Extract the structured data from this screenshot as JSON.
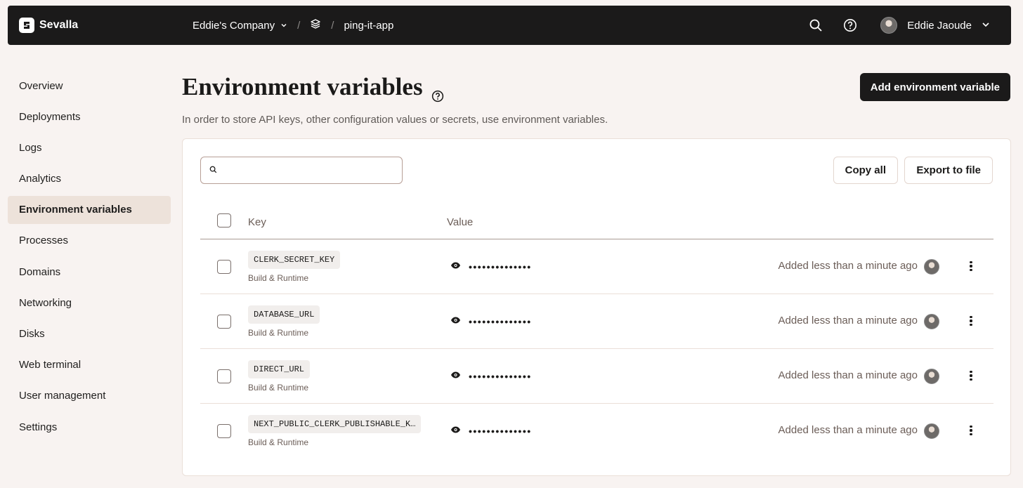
{
  "app": {
    "name": "Sevalla"
  },
  "breadcrumb": {
    "company": "Eddie's Company",
    "app_name": "ping-it-app"
  },
  "user": {
    "name": "Eddie Jaoude"
  },
  "sidebar": {
    "items": [
      {
        "label": "Overview"
      },
      {
        "label": "Deployments"
      },
      {
        "label": "Logs"
      },
      {
        "label": "Analytics"
      },
      {
        "label": "Environment variables",
        "active": true
      },
      {
        "label": "Processes"
      },
      {
        "label": "Domains"
      },
      {
        "label": "Networking"
      },
      {
        "label": "Disks"
      },
      {
        "label": "Web terminal"
      },
      {
        "label": "User management"
      },
      {
        "label": "Settings"
      }
    ]
  },
  "page": {
    "title": "Environment variables",
    "subtitle": "In order to store API keys, other configuration values or secrets, use environment variables.",
    "add_button": "Add environment variable"
  },
  "toolbar": {
    "search_placeholder": "",
    "copy_all": "Copy all",
    "export": "Export to file"
  },
  "table": {
    "headers": {
      "key": "Key",
      "value": "Value"
    },
    "rows": [
      {
        "key": "CLERK_SECRET_KEY",
        "scope": "Build & Runtime",
        "masked": "••••••••••••••",
        "added": "Added less than a minute ago"
      },
      {
        "key": "DATABASE_URL",
        "scope": "Build & Runtime",
        "masked": "••••••••••••••",
        "added": "Added less than a minute ago"
      },
      {
        "key": "DIRECT_URL",
        "scope": "Build & Runtime",
        "masked": "••••••••••••••",
        "added": "Added less than a minute ago"
      },
      {
        "key": "NEXT_PUBLIC_CLERK_PUBLISHABLE_K…",
        "scope": "Build & Runtime",
        "masked": "••••••••••••••",
        "added": "Added less than a minute ago"
      }
    ]
  },
  "colors": {
    "topbar": "#1b1a1a",
    "background": "#f8f3f1",
    "active_nav": "#ede2da",
    "muted_text": "#6b5d57"
  },
  "icons": [
    "sevalla-logo-icon",
    "chevron-down-icon",
    "layers-icon",
    "search-icon",
    "help-icon",
    "eye-icon",
    "more-vertical-icon"
  ]
}
